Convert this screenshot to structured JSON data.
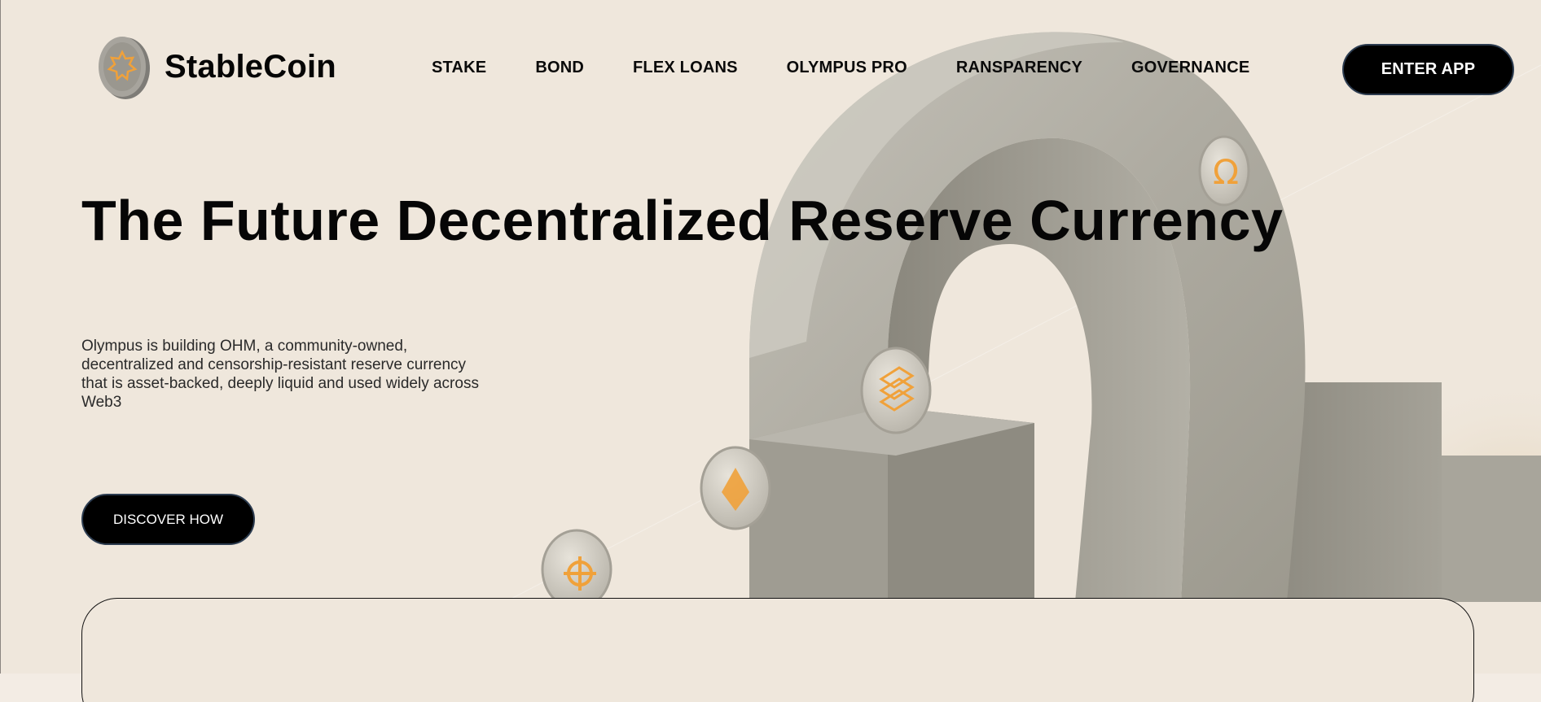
{
  "brand": {
    "name": "StableCoin",
    "logo_icon": "stablecoin-logo-icon"
  },
  "nav": {
    "items": [
      {
        "label": "STAKE"
      },
      {
        "label": "BOND"
      },
      {
        "label": "FLEX LOANS"
      },
      {
        "label": "OLYMPUS PRO"
      },
      {
        "label": "RANSPARENCY"
      },
      {
        "label": "GOVERNANCE"
      }
    ],
    "cta_label": "ENTER APP"
  },
  "hero": {
    "headline": "The Future Decentralized Reserve Currency",
    "description": "Olympus is building OHM, a community-owned, decentralized and censorship-resistant reserve currency that is asset-backed, deeply liquid and used widely across Web3",
    "button_label": "DISCOVER HOW",
    "art_icons": [
      "stone-arch-illustration",
      "ohm-coin-icon",
      "ethereum-coin-icon",
      "flower-coin-icon",
      "stacked-coin-icon"
    ]
  },
  "colors": {
    "background": "#efe7dc",
    "button": "#000000",
    "accent_coin_glyph": "#f0a13a",
    "stone": "#a9a69c"
  }
}
